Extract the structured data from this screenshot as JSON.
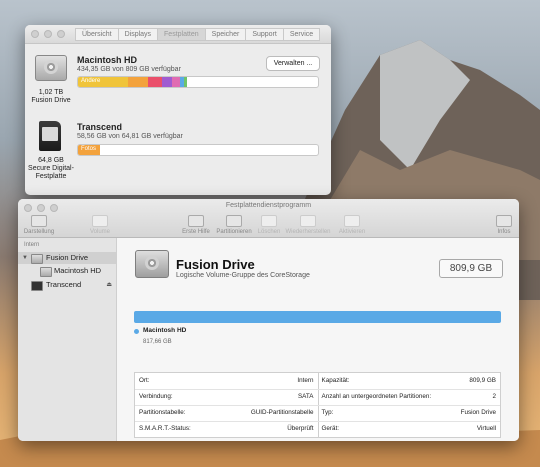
{
  "storage_window": {
    "tabs": [
      "Übersicht",
      "Displays",
      "Festplatten",
      "Speicher",
      "Support",
      "Service"
    ],
    "active_tab": 2,
    "drives": [
      {
        "name": "Macintosh HD",
        "detail": "434,35 GB von 809 GB verfügbar",
        "cap_size": "1,02 TB",
        "cap_type": "Fusion Drive",
        "bar_label": "Andere",
        "manage_label": "Verwalten ..."
      },
      {
        "name": "Transcend",
        "detail": "58,56 GB von 64,81 GB verfügbar",
        "cap_size": "64,8 GB",
        "cap_type": "Secure Digital-Festplatte",
        "bar_label": "Fotos"
      }
    ]
  },
  "disk_utility": {
    "title": "Festplattendienstprogramm",
    "toolbar": {
      "view": "Darstellung",
      "volume": "Volume",
      "first_aid": "Erste Hilfe",
      "partition": "Partitionieren",
      "erase": "Löschen",
      "restore": "Wiederherstellen",
      "unmount": "Aktivieren",
      "info": "Infos"
    },
    "sidebar": {
      "section": "Intern",
      "items": [
        "Fusion Drive",
        "Macintosh HD",
        "Transcend"
      ]
    },
    "volume": {
      "name": "Fusion Drive",
      "subtitle": "Logische Volume-Gruppe des CoreStorage",
      "size": "809,9 GB",
      "legend_name": "Macintosh HD",
      "legend_size": "817,66 GB"
    },
    "info_left": [
      {
        "k": "Ort:",
        "v": "Intern"
      },
      {
        "k": "Verbindung:",
        "v": "SATA"
      },
      {
        "k": "Partitionstabelle:",
        "v": "GUID-Partitionstabelle"
      },
      {
        "k": "S.M.A.R.T.-Status:",
        "v": "Überprüft"
      }
    ],
    "info_right": [
      {
        "k": "Kapazität:",
        "v": "809,9 GB"
      },
      {
        "k": "Anzahl an untergeordneten Partitionen:",
        "v": "2"
      },
      {
        "k": "Typ:",
        "v": "Fusion Drive"
      },
      {
        "k": "Gerät:",
        "v": "Virtuell"
      }
    ]
  },
  "colors": {
    "volume_blue": "#5aa9e6",
    "bar_yellow": "#f0c43a",
    "bar_orange": "#f3a23c"
  }
}
